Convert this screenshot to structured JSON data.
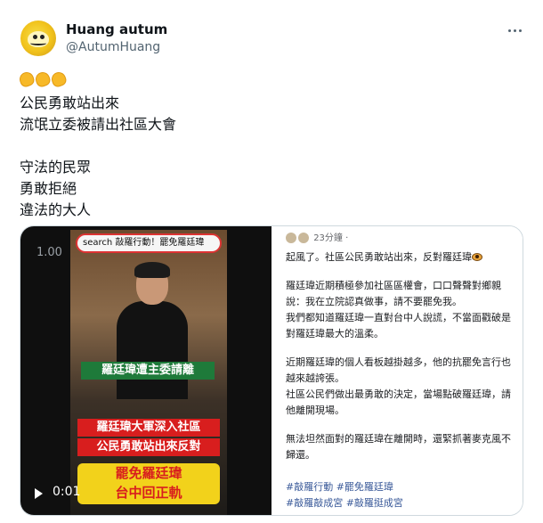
{
  "user": {
    "display_name": "Huang autum",
    "handle": "@AutumHuang"
  },
  "tweet": {
    "lines": [
      "公民勇敢站出來",
      "流氓立委被請出社區大會",
      "",
      "守法的民眾",
      "勇敢拒絕",
      "違法的大人"
    ],
    "emoji_icon": "clapping-hands-icon"
  },
  "video": {
    "top_timestamp": "1.00",
    "search_text": "search 敲羅行動！罷免羅廷瑋",
    "caption_green": "羅廷瑋遭主委請離",
    "caption_red_1": "羅廷瑋大軍深入社區",
    "caption_red_2": "公民勇敢站出來反對",
    "caption_big_1": "罷免羅廷瑋",
    "caption_big_2": "台中回正軌",
    "current_time": "0:01"
  },
  "embedded_post": {
    "timestamp": "23分鐘 ·",
    "paragraphs": [
      [
        "起風了。社區公民勇敢站出來，反對羅廷瑋"
      ],
      [
        "羅廷瑋近期積極參加社區區權會，口口聲聲對鄉親",
        "說：我在立院認真做事，請不要罷免我。",
        "我們都知道羅廷瑋一直對台中人說謊，不當面戳破是",
        "對羅廷瑋最大的溫柔。"
      ],
      [
        "近期羅廷瑋的個人看板越掛越多，他的抗罷免言行也",
        "越來越誇張。",
        "社區公民們做出最勇敢的決定，當場點破羅廷瑋，請",
        "他離開現場。"
      ],
      [
        "無法坦然面對的羅廷瑋在離開時，還緊抓著麥克風不",
        "歸還。"
      ]
    ],
    "hashtags": [
      "#敲羅行動 #罷免羅廷瑋",
      "#敲羅敲成宮 #敲羅挺成宮"
    ]
  }
}
